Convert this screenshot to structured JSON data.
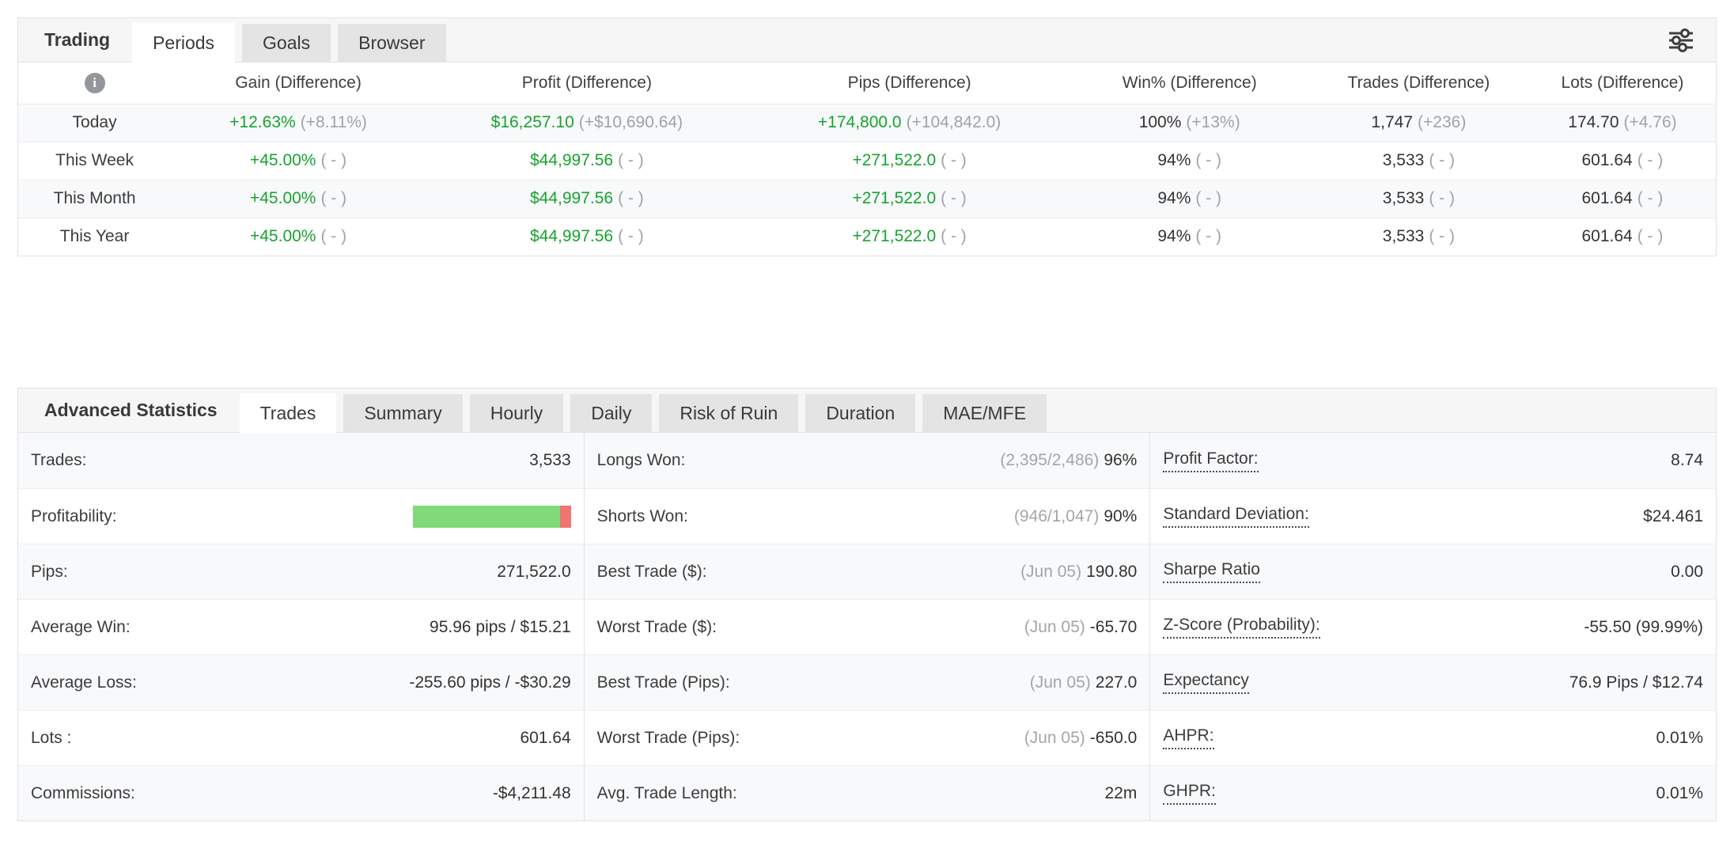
{
  "colors": {
    "positive_green": "#17a32f",
    "muted_gray": "#9fa3a7",
    "bar_green": "#80da77",
    "bar_red": "#f07474",
    "row_stripe": "#f8f9fb"
  },
  "trading": {
    "title": "Trading",
    "tabs": [
      "Periods",
      "Goals",
      "Browser"
    ],
    "active_tab": "Periods",
    "columns": [
      "Gain (Difference)",
      "Profit (Difference)",
      "Pips (Difference)",
      "Win% (Difference)",
      "Trades (Difference)",
      "Lots (Difference)"
    ],
    "rows": [
      {
        "label": "Today",
        "cells": [
          {
            "main": "+12.63%",
            "diff": "(+8.11%)"
          },
          {
            "main": "$16,257.10",
            "diff": "(+$10,690.64)"
          },
          {
            "main": "+174,800.0",
            "diff": "(+104,842.0)"
          },
          {
            "main": "100%",
            "diff": "(+13%)"
          },
          {
            "main": "1,747",
            "diff": "(+236)"
          },
          {
            "main": "174.70",
            "diff": "(+4.76)"
          }
        ]
      },
      {
        "label": "This Week",
        "cells": [
          {
            "main": "+45.00%",
            "diff": "( - )"
          },
          {
            "main": "$44,997.56",
            "diff": "( - )"
          },
          {
            "main": "+271,522.0",
            "diff": "( - )"
          },
          {
            "main": "94%",
            "diff": "( - )"
          },
          {
            "main": "3,533",
            "diff": "( - )"
          },
          {
            "main": "601.64",
            "diff": "( - )"
          }
        ]
      },
      {
        "label": "This Month",
        "cells": [
          {
            "main": "+45.00%",
            "diff": "( - )"
          },
          {
            "main": "$44,997.56",
            "diff": "( - )"
          },
          {
            "main": "+271,522.0",
            "diff": "( - )"
          },
          {
            "main": "94%",
            "diff": "( - )"
          },
          {
            "main": "3,533",
            "diff": "( - )"
          },
          {
            "main": "601.64",
            "diff": "( - )"
          }
        ]
      },
      {
        "label": "This Year",
        "cells": [
          {
            "main": "+45.00%",
            "diff": "( - )"
          },
          {
            "main": "$44,997.56",
            "diff": "( - )"
          },
          {
            "main": "+271,522.0",
            "diff": "( - )"
          },
          {
            "main": "94%",
            "diff": "( - )"
          },
          {
            "main": "3,533",
            "diff": "( - )"
          },
          {
            "main": "601.64",
            "diff": "( - )"
          }
        ]
      }
    ]
  },
  "advanced": {
    "title": "Advanced Statistics",
    "tabs": [
      "Trades",
      "Summary",
      "Hourly",
      "Daily",
      "Risk of Ruin",
      "Duration",
      "MAE/MFE"
    ],
    "active_tab": "Trades",
    "profitability": {
      "green_pct": 93,
      "red_pct": 7
    },
    "col1": [
      {
        "label": "Trades:",
        "value": "3,533"
      },
      {
        "label": "Profitability:",
        "value": ""
      },
      {
        "label": "Pips:",
        "value": "271,522.0"
      },
      {
        "label": "Average Win:",
        "value": "95.96 pips / $15.21"
      },
      {
        "label": "Average Loss:",
        "value": "-255.60 pips / -$30.29"
      },
      {
        "label": "Lots :",
        "value": "601.64"
      },
      {
        "label": "Commissions:",
        "value": "-$4,211.48"
      }
    ],
    "col2": [
      {
        "label": "Longs Won:",
        "muted": "(2,395/2,486)",
        "value": "96%"
      },
      {
        "label": "Shorts Won:",
        "muted": "(946/1,047)",
        "value": "90%"
      },
      {
        "label": "Best Trade ($):",
        "muted": "(Jun 05)",
        "value": "190.80"
      },
      {
        "label": "Worst Trade ($):",
        "muted": "(Jun 05)",
        "value": "-65.70"
      },
      {
        "label": "Best Trade (Pips):",
        "muted": "(Jun 05)",
        "value": "227.0"
      },
      {
        "label": "Worst Trade (Pips):",
        "muted": "(Jun 05)",
        "value": "-650.0"
      },
      {
        "label": "Avg. Trade Length:",
        "muted": "",
        "value": "22m"
      }
    ],
    "col3": [
      {
        "label": "Profit Factor:",
        "value": "8.74"
      },
      {
        "label": "Standard Deviation:",
        "value": "$24.461"
      },
      {
        "label": "Sharpe Ratio",
        "value": "0.00"
      },
      {
        "label": "Z-Score (Probability):",
        "value": "-55.50 (99.99%)"
      },
      {
        "label": "Expectancy",
        "value": "76.9 Pips / $12.74"
      },
      {
        "label": "AHPR:",
        "value": "0.01%"
      },
      {
        "label": "GHPR:",
        "value": "0.01%"
      }
    ]
  }
}
